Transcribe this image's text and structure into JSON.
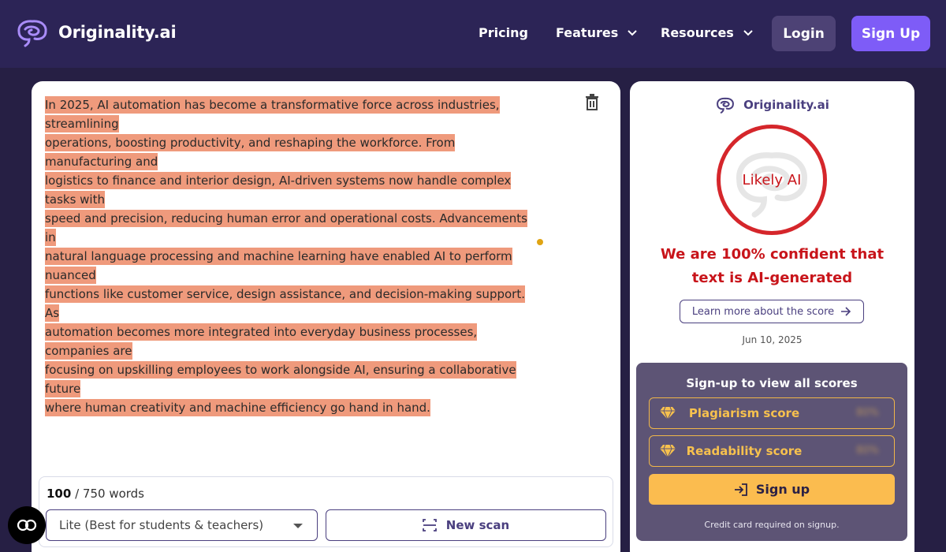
{
  "header": {
    "brand": "Originality.ai",
    "nav": [
      {
        "label": "Pricing",
        "dropdown": false
      },
      {
        "label": "Features",
        "dropdown": true
      },
      {
        "label": "Resources",
        "dropdown": true
      }
    ],
    "login_label": "Login",
    "signup_label": "Sign Up"
  },
  "editor": {
    "lines": [
      "In 2025, AI automation has become a transformative force across industries, streamlining",
      "operations, boosting productivity, and reshaping the workforce. From manufacturing and",
      "logistics to finance and interior design, AI-driven systems now handle complex tasks with",
      "speed and precision, reducing human error and operational costs. Advancements in",
      "natural language processing and machine learning have enabled AI to perform nuanced",
      "functions like customer service, design assistance, and decision-making support. As",
      "automation becomes more integrated into everyday business processes, companies are",
      "focusing on upskilling employees to work alongside AI, ensuring a collaborative future",
      "where human creativity and machine efficiency go hand in hand."
    ],
    "word_count": "100",
    "word_limit": "/ 750 words",
    "model_select_value": "Lite (Best for students & teachers)",
    "new_scan_label": "New scan"
  },
  "result": {
    "brand": "Originality.ai",
    "verdict": "Likely AI",
    "confidence_text": "We are 100% confident that text is AI-generated",
    "learn_more_label": "Learn more about the score",
    "date": "Jun 10, 2025",
    "locked_title": "Sign-up to view all scores",
    "locked_scores": [
      {
        "label": "Plagiarism score",
        "placeholder": "80%"
      },
      {
        "label": "Readability score",
        "placeholder": "80%"
      }
    ],
    "signup_cta": "Sign up",
    "cc_note": "Credit card required on signup."
  },
  "colors": {
    "page_bg": "#261f44",
    "header_bg": "#2c2456",
    "accent_purple": "#7e5cf7",
    "highlight": "#ef9a7c",
    "ai_red": "#c8141a",
    "cta_yellow": "#fbbc4f"
  }
}
